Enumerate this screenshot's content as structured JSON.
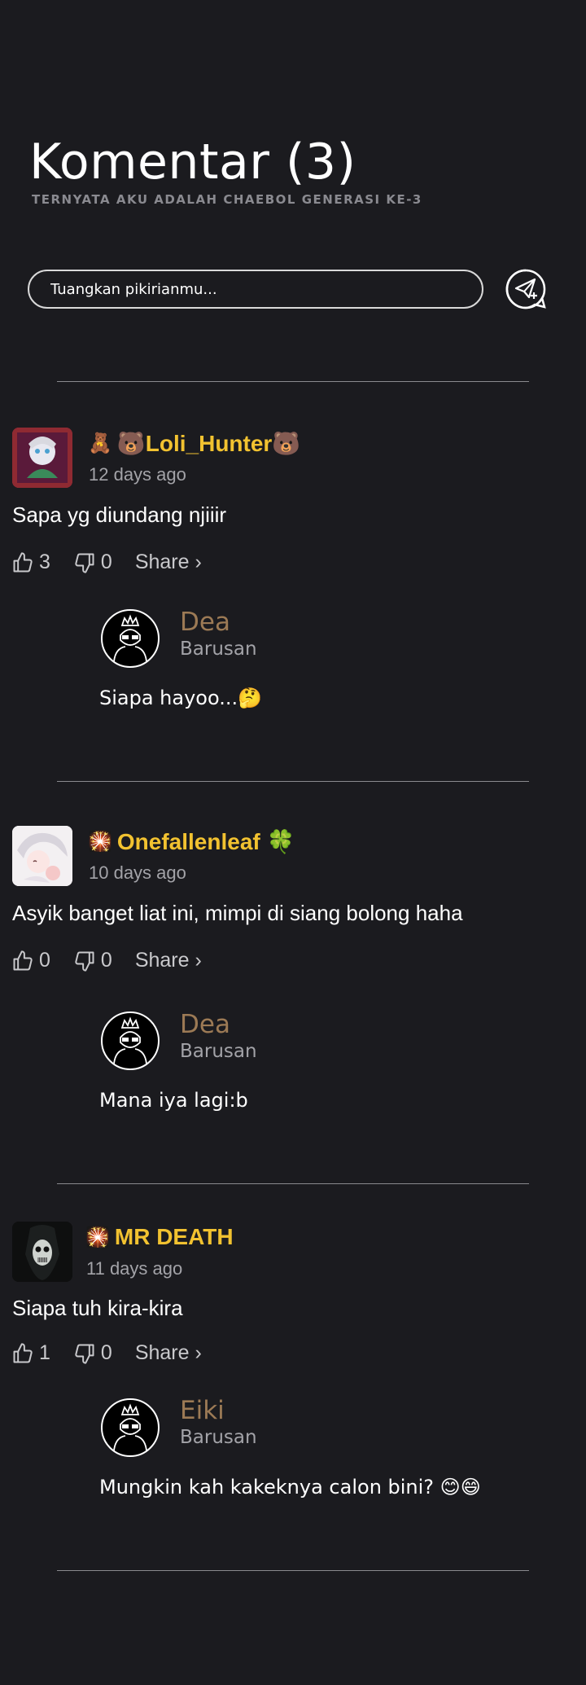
{
  "header": {
    "title": "Komentar (3)",
    "subtitle": "TERNYATA AKU ADALAH CHAEBOL GENERASI KE-3"
  },
  "comment_box": {
    "placeholder": "Tuangkan pikirianmu..."
  },
  "comments": [
    {
      "badge": "🧸",
      "username": "🐻Loli_Hunter🐻",
      "time": "12 days ago",
      "text": "Sapa yg diundang njiiir",
      "likes": "3",
      "dislikes": "0",
      "share_label": "Share ›",
      "reply": {
        "name": "Dea",
        "time": "Barusan",
        "text": "Siapa hayoo...🤔"
      }
    },
    {
      "badge": "🎇",
      "username": "Onefallenleaf 🍀",
      "time": "10 days ago",
      "text": "Asyik banget liat ini, mimpi di siang bolong haha",
      "likes": "0",
      "dislikes": "0",
      "share_label": "Share ›",
      "reply": {
        "name": "Dea",
        "time": "Barusan",
        "text": "Mana iya lagi:b"
      }
    },
    {
      "badge": "🎇",
      "username": "MR DEATH",
      "time": "11 days ago",
      "text": "Siapa tuh kira-kira",
      "likes": "1",
      "dislikes": "0",
      "share_label": "Share ›",
      "reply": {
        "name": "Eiki",
        "time": "Barusan",
        "text": "Mungkin kah kakeknya calon bini? 😊😄"
      }
    }
  ],
  "colors": {
    "background": "#1b1b1f",
    "username": "#f2c230",
    "reply_name": "#9c7a55",
    "muted": "#a3a3a8"
  }
}
